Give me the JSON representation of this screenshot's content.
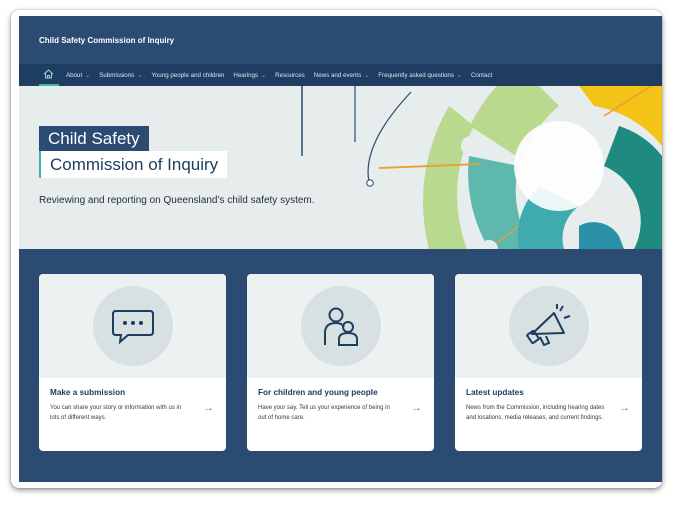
{
  "header": {
    "site_name": "Child Safety Commission of Inquiry"
  },
  "nav": {
    "home_icon": "home-icon",
    "items": [
      {
        "label": "About",
        "has_dropdown": true
      },
      {
        "label": "Submissions",
        "has_dropdown": true
      },
      {
        "label": "Young people and children",
        "has_dropdown": false
      },
      {
        "label": "Hearings",
        "has_dropdown": true
      },
      {
        "label": "Resources",
        "has_dropdown": false
      },
      {
        "label": "News and events",
        "has_dropdown": true
      },
      {
        "label": "Frequently asked questions",
        "has_dropdown": true
      },
      {
        "label": "Contact",
        "has_dropdown": false
      }
    ]
  },
  "hero": {
    "title_line1": "Child Safety",
    "title_line2": "Commission of Inquiry",
    "subtitle": "Reviewing and reporting on Queensland’s child safety system."
  },
  "cards": [
    {
      "icon": "chat-bubble-icon",
      "title": "Make a submission",
      "description": "You can share your story or information with us in lots of different ways.",
      "arrow": "→"
    },
    {
      "icon": "people-icon",
      "title": "For children and young people",
      "description": "Have your say. Tell us your experience of being in out of home care.",
      "arrow": "→"
    },
    {
      "icon": "megaphone-icon",
      "title": "Latest updates",
      "description": "News from the Commission, including hearing dates and locations, media releases, and current findings.",
      "arrow": "→"
    }
  ],
  "colors": {
    "navy": "#2b4b73",
    "nav_dark": "#1f3d60",
    "teal": "#3fb4a8",
    "green": "#a8cf7c",
    "yellow": "#f3c318",
    "orange": "#ef9a3a"
  }
}
